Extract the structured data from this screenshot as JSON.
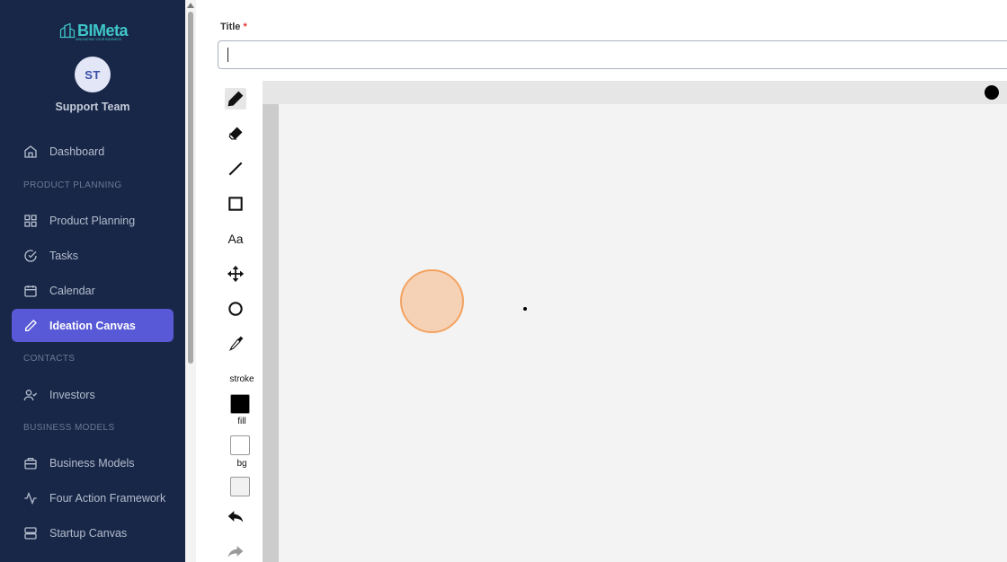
{
  "brand": {
    "name": "BIMeta",
    "tagline": "INNOVATING YOUR BUSINESS"
  },
  "user": {
    "initials": "ST",
    "name": "Support Team"
  },
  "nav": {
    "dashboard": "Dashboard",
    "section_product": "PRODUCT PLANNING",
    "product_planning": "Product Planning",
    "tasks": "Tasks",
    "calendar": "Calendar",
    "ideation_canvas": "Ideation Canvas",
    "section_contacts": "CONTACTS",
    "investors": "Investors",
    "section_business": "BUSINESS MODELS",
    "business_models": "Business Models",
    "four_action": "Four Action Framework",
    "startup_canvas": "Startup Canvas",
    "active": "ideation_canvas"
  },
  "form": {
    "title_label": "Title",
    "required_mark": "*",
    "title_value": ""
  },
  "toolbar": {
    "selected_tool": "pencil",
    "text_tool": "Aa",
    "stroke_label": "stroke",
    "fill_label": "fill",
    "bg_label": "bg"
  },
  "colors": {
    "stroke": "#000000",
    "fill": "#ffffff",
    "bg": "#f1f1f1",
    "accent": "#5859d7",
    "sidebar": "#182748"
  }
}
